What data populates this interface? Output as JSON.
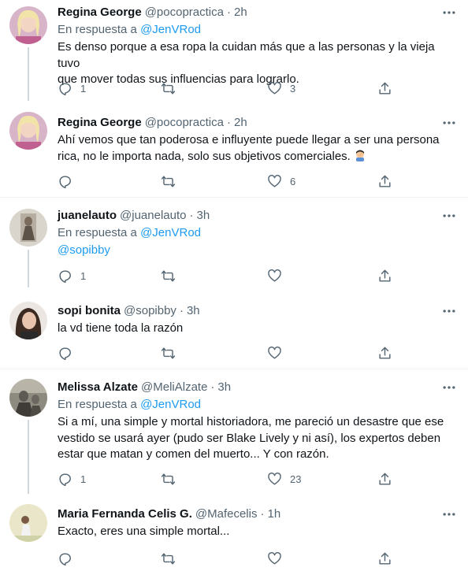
{
  "tweets": [
    {
      "name": "Regina George",
      "handle": "@pocopractica",
      "time": "2h",
      "reply_prefix": "En respuesta a",
      "reply_to": "@JenVRod",
      "line1": "Es denso porque a esa ropa la cuidan más que a las personas y la vieja tuvo",
      "line2": "que mover todas sus influencias para lograrlo.",
      "replies": "1",
      "retweets": "",
      "likes": "3"
    },
    {
      "name": "Regina George",
      "handle": "@pocopractica",
      "time": "2h",
      "line1": "Ahí vemos que tan poderosa e influyente puede llegar a ser una persona",
      "line2": "rica, no le importa nada, solo sus objetivos comerciales.",
      "emoji": "man-facepalming-emoji",
      "replies": "",
      "retweets": "",
      "likes": "6"
    },
    {
      "name": "juanelauto",
      "handle": "@juanelauto",
      "time": "3h",
      "reply_prefix": "En respuesta a",
      "reply_to": "@JenVRod",
      "mention_line": "@sopibby",
      "replies": "1",
      "retweets": "",
      "likes": ""
    },
    {
      "name": "sopi bonita",
      "handle": "@sopibby",
      "time": "3h",
      "line1": "la vd tiene toda la razón",
      "replies": "",
      "retweets": "",
      "likes": ""
    },
    {
      "name": "Melissa Alzate",
      "handle": "@MeliAlzate",
      "time": "3h",
      "reply_prefix": "En respuesta a",
      "reply_to": "@JenVRod",
      "line1": "Si a mí, una simple y mortal historiadora, me pareció un desastre que ese",
      "line2": "vestido se usará ayer (pudo ser Blake Lively y ni así), los expertos deben",
      "line3": "estar que matan y comen del muerto... Y con razón.",
      "replies": "1",
      "retweets": "",
      "likes": "23"
    },
    {
      "name": "Maria Fernanda Celis G.",
      "handle": "@Mafecelis",
      "time": "1h",
      "line1": "Exacto, eres una simple mortal...",
      "replies": "",
      "retweets": "",
      "likes": ""
    }
  ],
  "separator": "·",
  "colors": {
    "text": "#0f1419",
    "secondary": "#536471",
    "link": "#1d9bf0",
    "border": "#eff3f4",
    "thread": "#cfd9de"
  }
}
